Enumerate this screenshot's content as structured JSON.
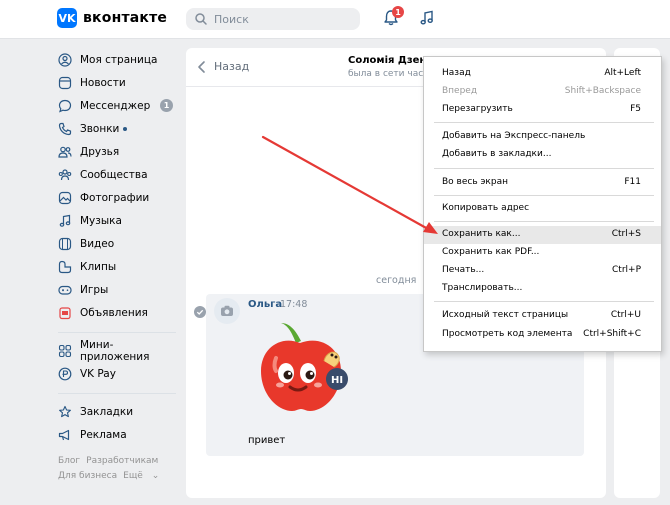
{
  "header": {
    "logo_text": "вконтакте",
    "logo_letters": "VK",
    "search_placeholder": "Поиск",
    "notifications_count": "1"
  },
  "sidebar": {
    "items": [
      {
        "label": "Моя страница",
        "icon": "user-circle-icon"
      },
      {
        "label": "Новости",
        "icon": "news-icon"
      },
      {
        "label": "Мессенджер",
        "icon": "message-icon",
        "count": "1"
      },
      {
        "label": "Звонки",
        "icon": "phone-icon",
        "dot": true
      },
      {
        "label": "Друзья",
        "icon": "friends-icon"
      },
      {
        "label": "Сообщества",
        "icon": "communities-icon"
      },
      {
        "label": "Фотографии",
        "icon": "photo-icon"
      },
      {
        "label": "Музыка",
        "icon": "music-icon"
      },
      {
        "label": "Видео",
        "icon": "video-icon"
      },
      {
        "label": "Клипы",
        "icon": "clips-icon"
      },
      {
        "label": "Игры",
        "icon": "gamepad-icon"
      },
      {
        "label": "Объявления",
        "icon": "ads-icon"
      },
      {
        "label": "Мини-приложения",
        "icon": "apps-icon"
      },
      {
        "label": "VK Pay",
        "icon": "vkpay-icon"
      },
      {
        "label": "Закладки",
        "icon": "star-icon"
      },
      {
        "label": "Реклама",
        "icon": "megaphone-icon"
      }
    ],
    "footer": [
      "Блог",
      "Разработчикам",
      "Для бизнеса",
      "Ещё"
    ]
  },
  "chat": {
    "back_label": "Назад",
    "name": "Соломія Дзенд",
    "status": "была в сети час наз",
    "date_divider": "сегодня",
    "message": {
      "author": "Ольга",
      "time": "17:48",
      "text": "привет",
      "sticker_badge": "HI"
    }
  },
  "context_menu": {
    "items": [
      {
        "label": "Назад",
        "shortcut": "Alt+Left",
        "disabled": false
      },
      {
        "label": "Вперед",
        "shortcut": "Shift+Backspace",
        "disabled": true
      },
      {
        "label": "Перезагрузить",
        "shortcut": "F5",
        "disabled": false
      },
      {
        "label": "Добавить на Экспресс-панель",
        "shortcut": "",
        "disabled": false
      },
      {
        "label": "Добавить в закладки...",
        "shortcut": "",
        "disabled": false
      },
      {
        "label": "Во весь экран",
        "shortcut": "F11",
        "disabled": false
      },
      {
        "label": "Копировать адрес",
        "shortcut": "",
        "disabled": false
      },
      {
        "label": "Сохранить как...",
        "shortcut": "Ctrl+S",
        "disabled": false,
        "highlighted": true
      },
      {
        "label": "Сохранить как PDF...",
        "shortcut": "",
        "disabled": false
      },
      {
        "label": "Печать...",
        "shortcut": "Ctrl+P",
        "disabled": false
      },
      {
        "label": "Транслировать...",
        "shortcut": "",
        "disabled": false
      },
      {
        "label": "Исходный текст страницы",
        "shortcut": "Ctrl+U",
        "disabled": false
      },
      {
        "label": "Просмотреть код элемента",
        "shortcut": "Ctrl+Shift+C",
        "disabled": false
      }
    ]
  },
  "colors": {
    "vk_blue": "#0077ff",
    "link_blue": "#2a5885",
    "badge_red": "#e64646",
    "annotation_arrow": "#e53935"
  }
}
